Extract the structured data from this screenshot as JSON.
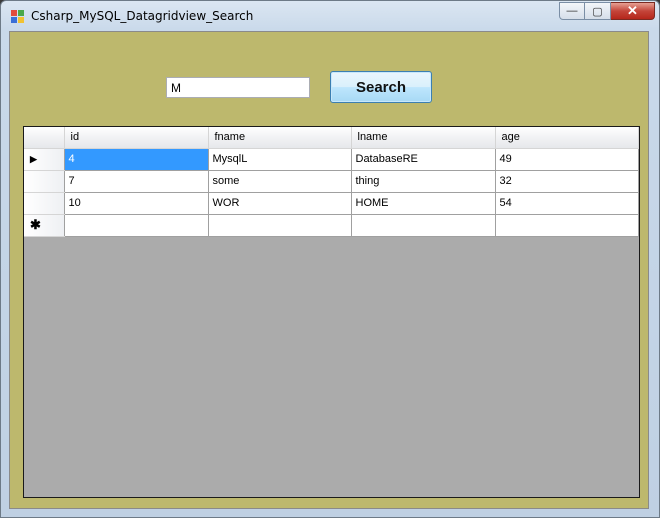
{
  "window": {
    "title": "Csharp_MySQL_Datagridview_Search",
    "caption_buttons": {
      "minimize": "—",
      "maximize": "▢",
      "close": "✕"
    }
  },
  "search": {
    "value": "M",
    "button_label": "Search"
  },
  "grid": {
    "columns": [
      "id",
      "fname",
      "lname",
      "age"
    ],
    "rows": [
      {
        "id": "4",
        "fname": "MysqlL",
        "lname": "DatabaseRE",
        "age": "49"
      },
      {
        "id": "7",
        "fname": "some",
        "lname": "thing",
        "age": "32"
      },
      {
        "id": "10",
        "fname": "WOR",
        "lname": "HOME",
        "age": "54"
      }
    ],
    "current_row_marker": "▶",
    "new_row_marker": "✱"
  },
  "colors": {
    "client_background": "#bdb86d",
    "grid_empty_area": "#ababab",
    "selected_cell": "#3399ff"
  }
}
